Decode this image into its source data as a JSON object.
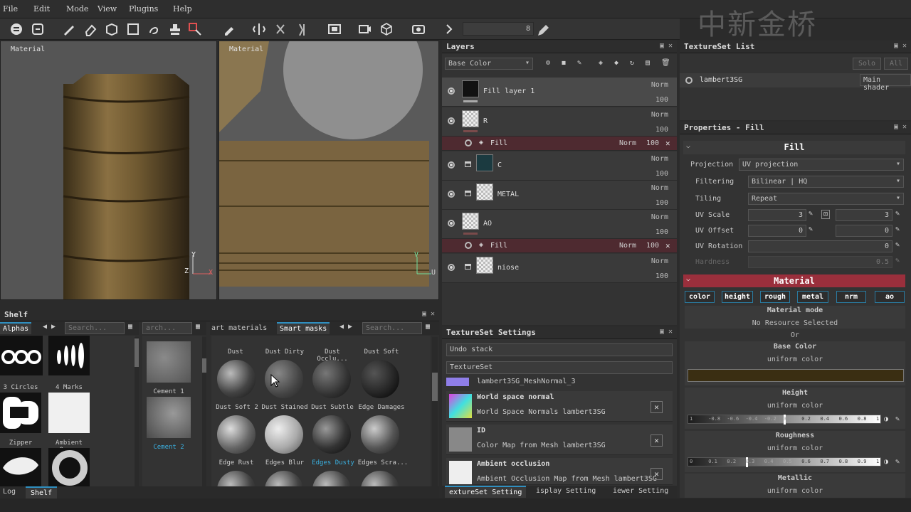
{
  "menu": [
    "File",
    "Edit",
    "Mode",
    "View",
    "Plugins",
    "Help"
  ],
  "watermark": "中新金桥",
  "toolbar": {
    "size_value": "8"
  },
  "viewport3d": {
    "label": "Material",
    "axis_y": "Y",
    "axis_z": "Z",
    "axis_x": "X"
  },
  "viewport2d": {
    "label": "Material",
    "axis_v": "V",
    "axis_u": "U"
  },
  "layers": {
    "title": "Layers",
    "channel_select": "Base Color",
    "items": [
      {
        "name": "Fill layer 1",
        "blend": "Norm",
        "opacity": "100"
      },
      {
        "name": "R",
        "blend": "Norm",
        "opacity": "100"
      },
      {
        "name": "C",
        "blend": "Norm",
        "opacity": "100"
      },
      {
        "name": "METAL",
        "blend": "Norm",
        "opacity": "100"
      },
      {
        "name": "AO",
        "blend": "Norm",
        "opacity": "100"
      },
      {
        "name": "niose",
        "blend": "Norm",
        "opacity": "100"
      }
    ],
    "fill_effects": [
      {
        "name": "Fill",
        "blend": "Norm",
        "opacity": "100",
        "close": "✕"
      },
      {
        "name": "Fill",
        "blend": "Norm",
        "opacity": "100",
        "close": "✕"
      }
    ]
  },
  "texture_set_list": {
    "title": "TextureSet List",
    "solo": "Solo",
    "all": "All",
    "entry": "lambert3SG",
    "shader": "Main shader"
  },
  "properties": {
    "title": "Properties - Fill",
    "section": "Fill",
    "projection_label": "Projection",
    "projection_value": "UV projection",
    "filtering_label": "Filtering",
    "filtering_value": "Bilinear | HQ",
    "tiling_label": "Tiling",
    "tiling_value": "Repeat",
    "uv_scale_label": "UV Scale",
    "uv_scale_a": "3",
    "uv_scale_b": "3",
    "uv_offset_label": "UV Offset",
    "uv_offset_a": "0",
    "uv_offset_b": "0",
    "uv_rotation_label": "UV Rotation",
    "uv_rotation_value": "0",
    "hardness_label": "Hardness",
    "hardness_value": "0.5",
    "material_section": "Material",
    "channel_tabs": [
      "color",
      "height",
      "rough",
      "metal",
      "nrm",
      "ao"
    ],
    "material_mode_label": "Material mode",
    "material_mode_value": "No Resource Selected",
    "or": "Or",
    "base_color_label": "Base Color",
    "base_color_sub": "uniform color",
    "base_color_hex": "#3a2e12",
    "height_label": "Height",
    "height_sub": "uniform color",
    "height_ticks": [
      "1",
      "-0.8",
      "-0.6",
      "-0.4",
      "-0.2",
      "0",
      "0.2",
      "0.4",
      "0.6",
      "0.8",
      "1"
    ],
    "roughness_label": "Roughness",
    "roughness_sub": "uniform color",
    "roughness_ticks": [
      "0",
      "0.1",
      "0.2",
      "0.3",
      "0.4",
      "0.5",
      "0.6",
      "0.7",
      "0.8",
      "0.9",
      "1"
    ],
    "metallic_label": "Metallic",
    "metallic_sub": "uniform color"
  },
  "texset_settings": {
    "title": "TextureSet Settings",
    "undo_stack": "Undo stack",
    "textureset": "TextureSet",
    "mesh_normal": "lambert3SG_MeshNormal_3",
    "entries": [
      {
        "title": "World space normal",
        "sub": "World Space Normals lambert3SG"
      },
      {
        "title": "ID",
        "sub": "Color Map from Mesh lambert3SG"
      },
      {
        "title": "Ambient occlusion",
        "sub": "Ambient Occlusion Map from Mesh lambert3SG"
      }
    ],
    "bottom_tabs": [
      "extureSet Setting",
      "isplay Setting",
      "iewer Setting"
    ]
  },
  "shelf": {
    "title": "Shelf",
    "tab_alphas": "Alphas",
    "search_placeholder": "Search...",
    "search2_placeholder": "arch...",
    "tab_smart_materials": "art materials",
    "tab_smart_masks": "Smart masks",
    "search3_placeholder": "Search...",
    "alphas": [
      "3 Circles",
      "4 Marks",
      "Zipper",
      "Ambient Oc..."
    ],
    "procedurals": [
      "Cement 1",
      "Cement 2"
    ],
    "masks_row0": [
      "Dust",
      "Dust Dirty",
      "Dust Occlu...",
      "Dust Soft"
    ],
    "masks_row1": [
      "Dust Soft 2",
      "Dust Stained",
      "Dust Subtle",
      "Edge Damages"
    ],
    "masks_row2": [
      "Edge Rust",
      "Edges Blur",
      "Edges Dusty",
      "Edges Scra..."
    ]
  },
  "bottom_tabs": [
    "Log",
    "Shelf"
  ]
}
